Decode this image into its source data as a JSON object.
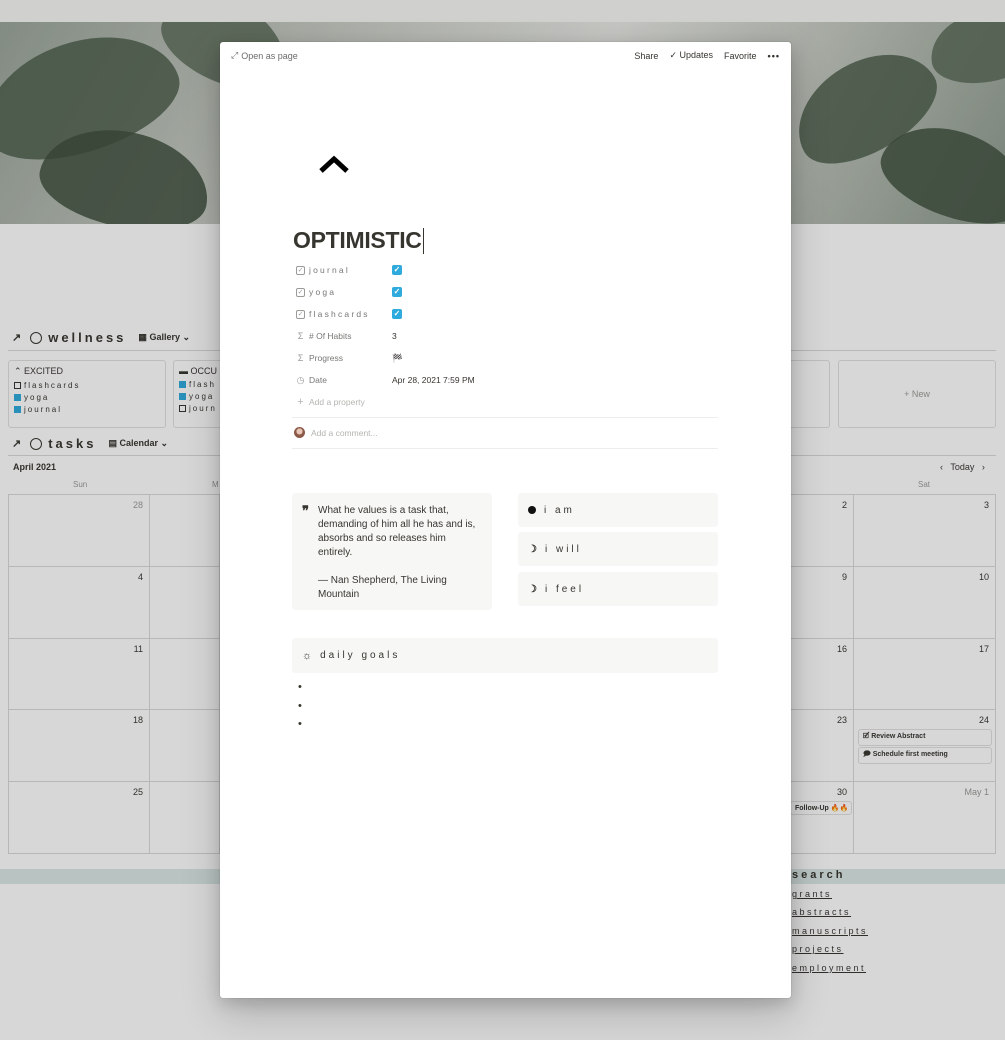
{
  "background": {
    "wellness": {
      "title": "wellness",
      "view": "Gallery",
      "cards": [
        {
          "title": "EXCITED",
          "items": [
            {
              "label": "flashcards",
              "checked": false
            },
            {
              "label": "yoga",
              "checked": true
            },
            {
              "label": "journal",
              "checked": true
            }
          ]
        },
        {
          "title": "OCCU",
          "items": [
            {
              "label": "flash",
              "checked": true
            },
            {
              "label": "yoga",
              "checked": true
            },
            {
              "label": "journ",
              "checked": false
            }
          ]
        }
      ],
      "new_label": "+ New"
    },
    "tasks": {
      "title": "tasks",
      "view": "Calendar",
      "month": "April 2021",
      "today_label": "Today",
      "dow_sun": "Sun",
      "dow_mon": "M",
      "dow_sat": "Sat",
      "left_days": [
        "28",
        "4",
        "11",
        "18",
        "25"
      ],
      "col6_days": [
        "2",
        "9",
        "16",
        "23",
        "30"
      ],
      "col7_days": [
        "3",
        "10",
        "17",
        "24",
        "May 1"
      ],
      "events": {
        "review": "Review Abstract",
        "schedule": "Schedule first meeting",
        "followup": "Follow-Up 🔥🔥"
      }
    },
    "research": {
      "title": "search",
      "links": [
        "grants",
        "abstracts",
        "manuscripts",
        "projects",
        "employment"
      ]
    }
  },
  "modal": {
    "open_as_page": "Open as page",
    "share": "Share",
    "updates": "Updates",
    "favorite": "Favorite",
    "more": "•••",
    "title": "OPTIMISTIC",
    "properties": {
      "journal": {
        "label": "journal",
        "checked": true
      },
      "yoga": {
        "label": "yoga",
        "checked": true
      },
      "flashcards": {
        "label": "flashcards",
        "checked": true
      },
      "habits": {
        "label": "# Of Habits",
        "value": "3"
      },
      "progress": {
        "label": "Progress",
        "value": "🏁"
      },
      "date": {
        "label": "Date",
        "value": "Apr 28, 2021 7:59 PM"
      },
      "add": "Add a property"
    },
    "comment_placeholder": "Add a comment...",
    "quote": {
      "text": "What he values is a task that, demanding of him all he has and is, absorbs and so releases him entirely.",
      "attribution": "— Nan Shepherd, The Living Mountain"
    },
    "callouts": {
      "i_am": "i am",
      "i_will": "i will",
      "i_feel": "i feel"
    },
    "daily_goals": "daily goals",
    "bullets": [
      "",
      "",
      ""
    ]
  }
}
